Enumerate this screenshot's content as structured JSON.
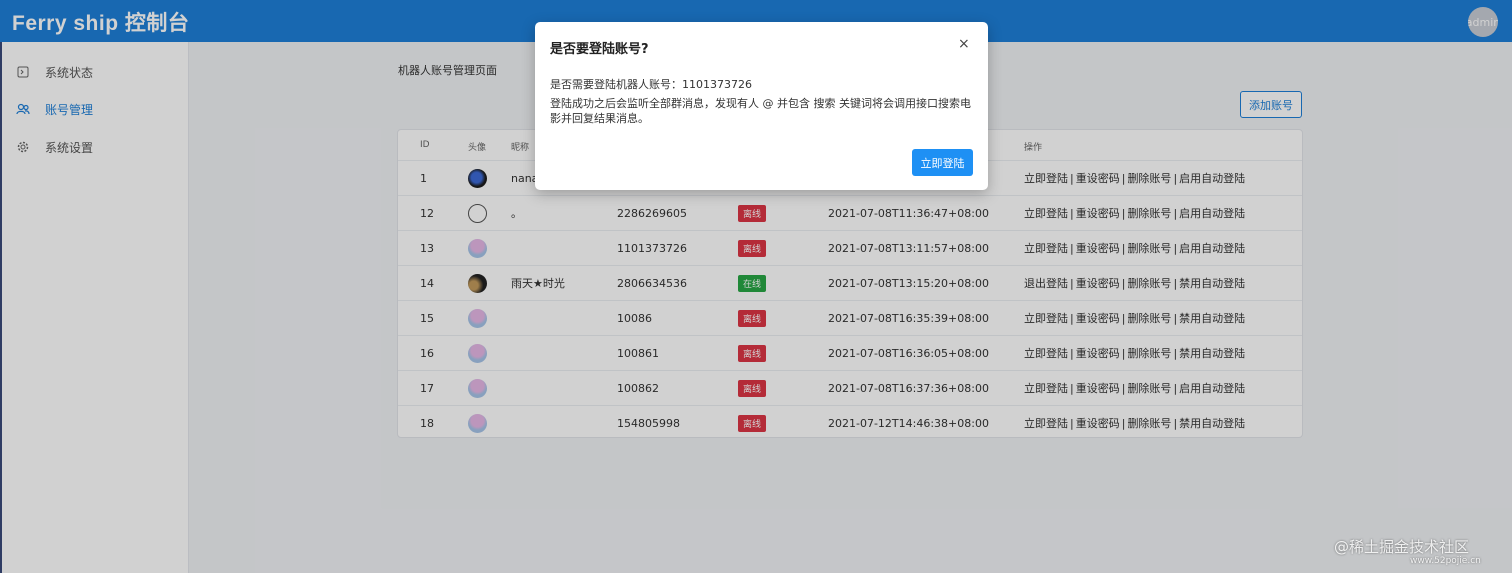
{
  "header": {
    "title": "Ferry ship 控制台",
    "avatar_text": "admin"
  },
  "sidebar": {
    "items": [
      {
        "label": "系统状态",
        "icon": "status-icon"
      },
      {
        "label": "账号管理",
        "icon": "users-icon",
        "active": true
      },
      {
        "label": "系统设置",
        "icon": "gear-icon"
      }
    ]
  },
  "main": {
    "page_label": "机器人账号管理页面",
    "add_button": "添加账号"
  },
  "table": {
    "columns": [
      "ID",
      "头像",
      "昵称",
      "",
      "",
      "",
      "操作"
    ],
    "rows": [
      {
        "id": "1",
        "avatar": "dark",
        "nickname": "nana",
        "account": "",
        "status": "",
        "time": "",
        "actions": [
          "立即登陆",
          "重设密码",
          "删除账号",
          "启用自动登陆"
        ]
      },
      {
        "id": "12",
        "avatar": "eye",
        "nickname": "。",
        "account": "2286269605",
        "status": "离线",
        "time": "2021-07-08T11:36:47+08:00",
        "actions": [
          "立即登陆",
          "重设密码",
          "删除账号",
          "启用自动登陆"
        ]
      },
      {
        "id": "13",
        "avatar": "pink",
        "nickname": "",
        "account": "1101373726",
        "status": "离线",
        "time": "2021-07-08T13:11:57+08:00",
        "actions": [
          "立即登陆",
          "重设密码",
          "删除账号",
          "启用自动登陆"
        ]
      },
      {
        "id": "14",
        "avatar": "night",
        "nickname": "雨天★时光",
        "account": "2806634536",
        "status": "在线",
        "time": "2021-07-08T13:15:20+08:00",
        "actions": [
          "退出登陆",
          "重设密码",
          "删除账号",
          "禁用自动登陆"
        ]
      },
      {
        "id": "15",
        "avatar": "pink",
        "nickname": "",
        "account": "10086",
        "status": "离线",
        "time": "2021-07-08T16:35:39+08:00",
        "actions": [
          "立即登陆",
          "重设密码",
          "删除账号",
          "禁用自动登陆"
        ]
      },
      {
        "id": "16",
        "avatar": "pink",
        "nickname": "",
        "account": "100861",
        "status": "离线",
        "time": "2021-07-08T16:36:05+08:00",
        "actions": [
          "立即登陆",
          "重设密码",
          "删除账号",
          "禁用自动登陆"
        ]
      },
      {
        "id": "17",
        "avatar": "pink",
        "nickname": "",
        "account": "100862",
        "status": "离线",
        "time": "2021-07-08T16:37:36+08:00",
        "actions": [
          "立即登陆",
          "重设密码",
          "删除账号",
          "启用自动登陆"
        ]
      },
      {
        "id": "18",
        "avatar": "pink",
        "nickname": "",
        "account": "154805998",
        "status": "离线",
        "time": "2021-07-12T14:46:38+08:00",
        "actions": [
          "立即登陆",
          "重设密码",
          "删除账号",
          "禁用自动登陆"
        ]
      }
    ]
  },
  "modal": {
    "title": "是否要登陆账号?",
    "close": "×",
    "line1": "是否需要登陆机器人账号：1101373726",
    "line2": "登陆成功之后会监听全部群消息，发现有人 @ 并包含 搜索 关键词将会调用接口搜索电影并回复结果消息。",
    "confirm": "立即登陆"
  },
  "watermark": {
    "main": "@稀土掘金技术社区",
    "sub": "www.52pojie.cn"
  },
  "colors": {
    "primary": "#1e7fd8",
    "offline": "#dc3545",
    "online": "#28a745"
  }
}
